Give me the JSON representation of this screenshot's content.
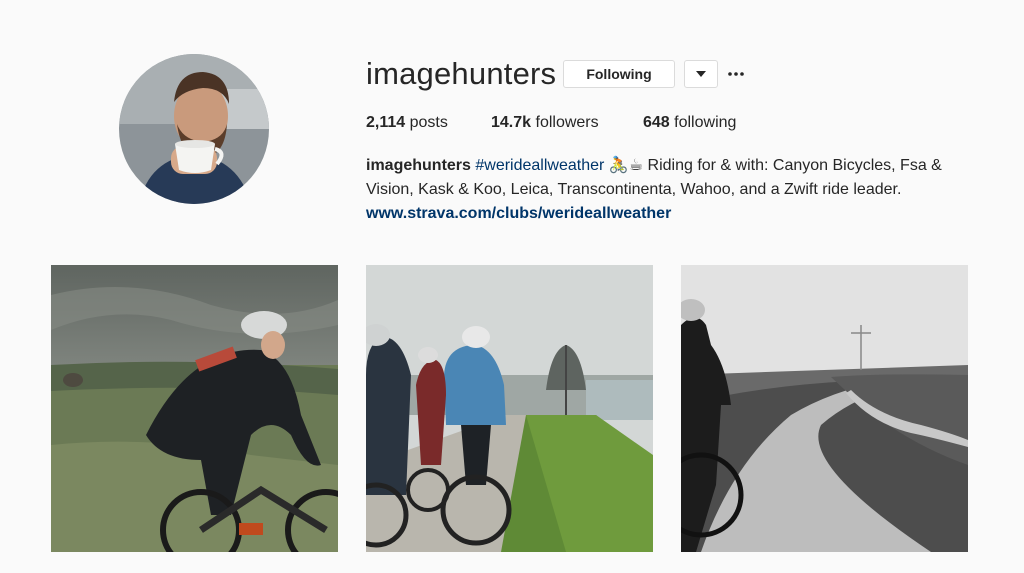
{
  "profile": {
    "username": "imagehunters",
    "follow_label": "Following",
    "stats": {
      "posts_count": "2,114",
      "posts_label": "posts",
      "followers_count": "14.7k",
      "followers_label": "followers",
      "following_count": "648",
      "following_label": "following"
    },
    "bio": {
      "name": "imagehunters",
      "hashtag": "#werideallweather",
      "emoji": "🚴☕",
      "text": " Riding for & with: Canyon Bicycles, Fsa & Vision, Kask & Koo, Leica, Transcontinenta, Wahoo, and a Zwift ride leader.",
      "link": "www.strava.com/clubs/werideallweather"
    }
  },
  "icons": {
    "dropdown": "chevron-down-icon",
    "more": "more-horizontal-icon"
  },
  "colors": {
    "background": "#fafafa",
    "text": "#262626",
    "link": "#003569",
    "border": "#dbdbdb"
  }
}
